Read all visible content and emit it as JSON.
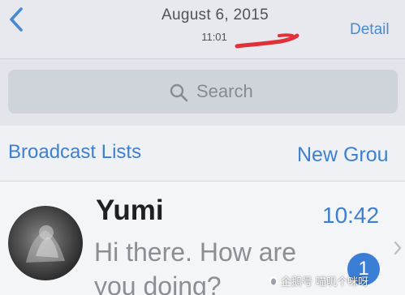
{
  "colors": {
    "accent": "#3d7fd0",
    "badge": "#3b7ed6",
    "redaction": "#e0313a"
  },
  "navbar": {
    "back_icon": "chevron-left-icon",
    "title": "August 6, 2015",
    "subtitle": "11:01",
    "detail_label": "Detail"
  },
  "search": {
    "icon": "search-icon",
    "placeholder": "Search"
  },
  "links": {
    "broadcast_label": "Broadcast Lists",
    "new_group_label": "New Grou"
  },
  "chat": {
    "name": "Yumi",
    "time": "10:42",
    "preview": "Hi there. How are you doing?",
    "unread_count": "1",
    "chevron_icon": "chevron-right-icon"
  },
  "watermark": {
    "text": "企鹅号 喵叽个咪呀"
  }
}
